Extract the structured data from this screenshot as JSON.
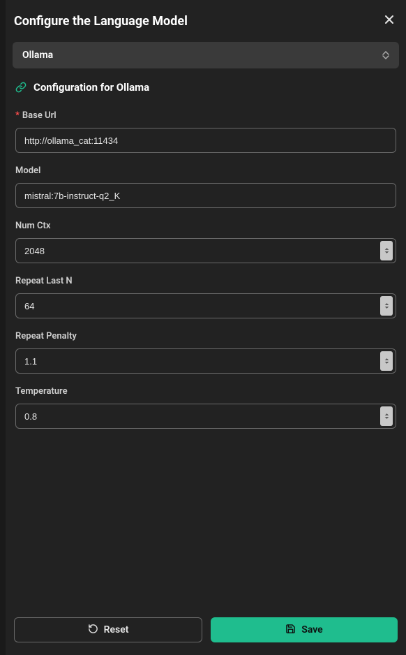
{
  "header": {
    "title": "Configure the Language Model"
  },
  "provider": {
    "selected": "Ollama"
  },
  "config_section": {
    "heading": "Configuration for Ollama"
  },
  "fields": {
    "base_url": {
      "label": "Base Url",
      "value": "http://ollama_cat:11434",
      "required": true
    },
    "model": {
      "label": "Model",
      "value": "mistral:7b-instruct-q2_K"
    },
    "num_ctx": {
      "label": "Num Ctx",
      "value": "2048"
    },
    "repeat_last_n": {
      "label": "Repeat Last N",
      "value": "64"
    },
    "repeat_penalty": {
      "label": "Repeat Penalty",
      "value": "1.1"
    },
    "temperature": {
      "label": "Temperature",
      "value": "0.8"
    }
  },
  "buttons": {
    "reset": "Reset",
    "save": "Save"
  }
}
